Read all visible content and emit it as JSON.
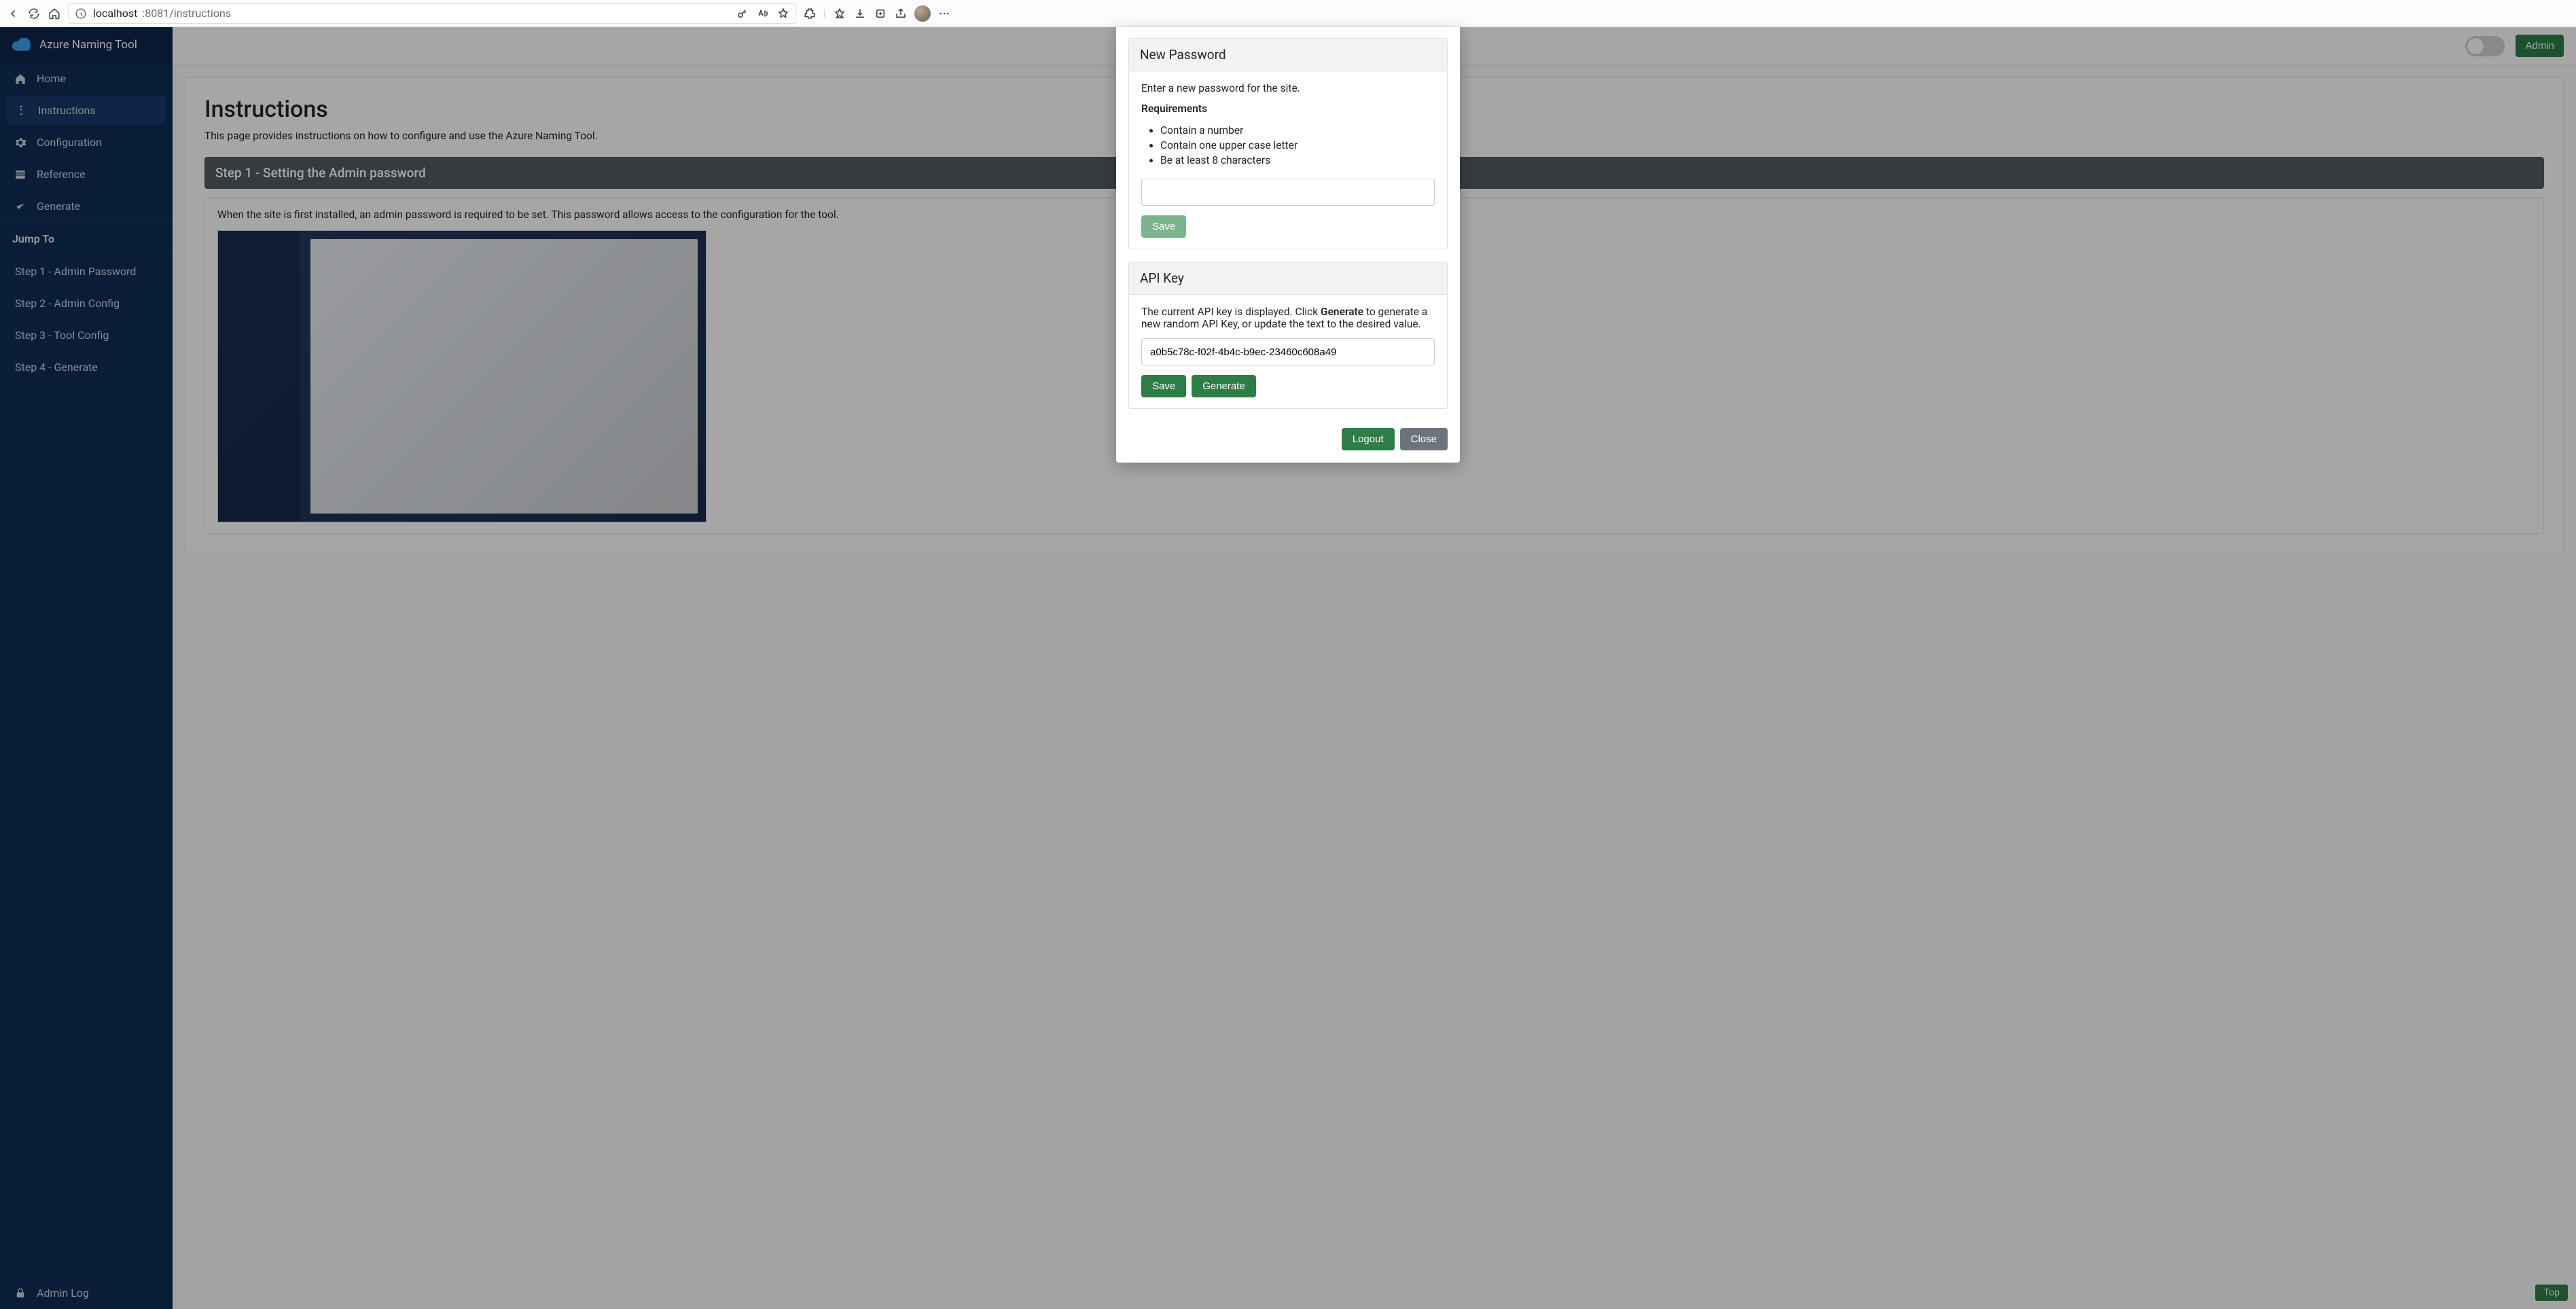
{
  "browser": {
    "url_host": "localhost",
    "url_rest": ":8081/instructions"
  },
  "brand": {
    "title": "Azure Naming Tool"
  },
  "sidebar": {
    "items": [
      {
        "label": "Home"
      },
      {
        "label": "Instructions"
      },
      {
        "label": "Configuration"
      },
      {
        "label": "Reference"
      },
      {
        "label": "Generate"
      }
    ],
    "jump_header": "Jump To",
    "jump_items": [
      {
        "label": "Step 1 - Admin Password"
      },
      {
        "label": "Step 2 - Admin Config"
      },
      {
        "label": "Step 3 - Tool Config"
      },
      {
        "label": "Step 4 - Generate"
      }
    ],
    "admin_log": "Admin Log"
  },
  "topbar": {
    "admin_label": "Admin"
  },
  "page": {
    "title": "Instructions",
    "subtitle_full": "This page provides instructions on how to configure and use the Azure Naming Tool.",
    "step_header": "Step 1 - Setting the Admin password",
    "step_desc_full": "When the site is first installed, an admin password is required to be set. This password allows access to the configuration for the tool."
  },
  "modal": {
    "new_password": {
      "header": "New Password",
      "intro": "Enter a new password for the site.",
      "req_title": "Requirements",
      "reqs": [
        "Contain a number",
        "Contain one upper case letter",
        "Be at least 8 characters"
      ],
      "value": "",
      "save_label": "Save"
    },
    "api_key": {
      "header": "API Key",
      "desc_before": "The current API key is displayed. Click ",
      "desc_strong": "Generate",
      "desc_after": " to generate a new random API Key, or update the text to the desired value.",
      "value": "a0b5c78c-f02f-4b4c-b9ec-23460c608a49",
      "save_label": "Save",
      "generate_label": "Generate"
    },
    "footer": {
      "logout": "Logout",
      "close": "Close"
    }
  },
  "top_button": "Top"
}
